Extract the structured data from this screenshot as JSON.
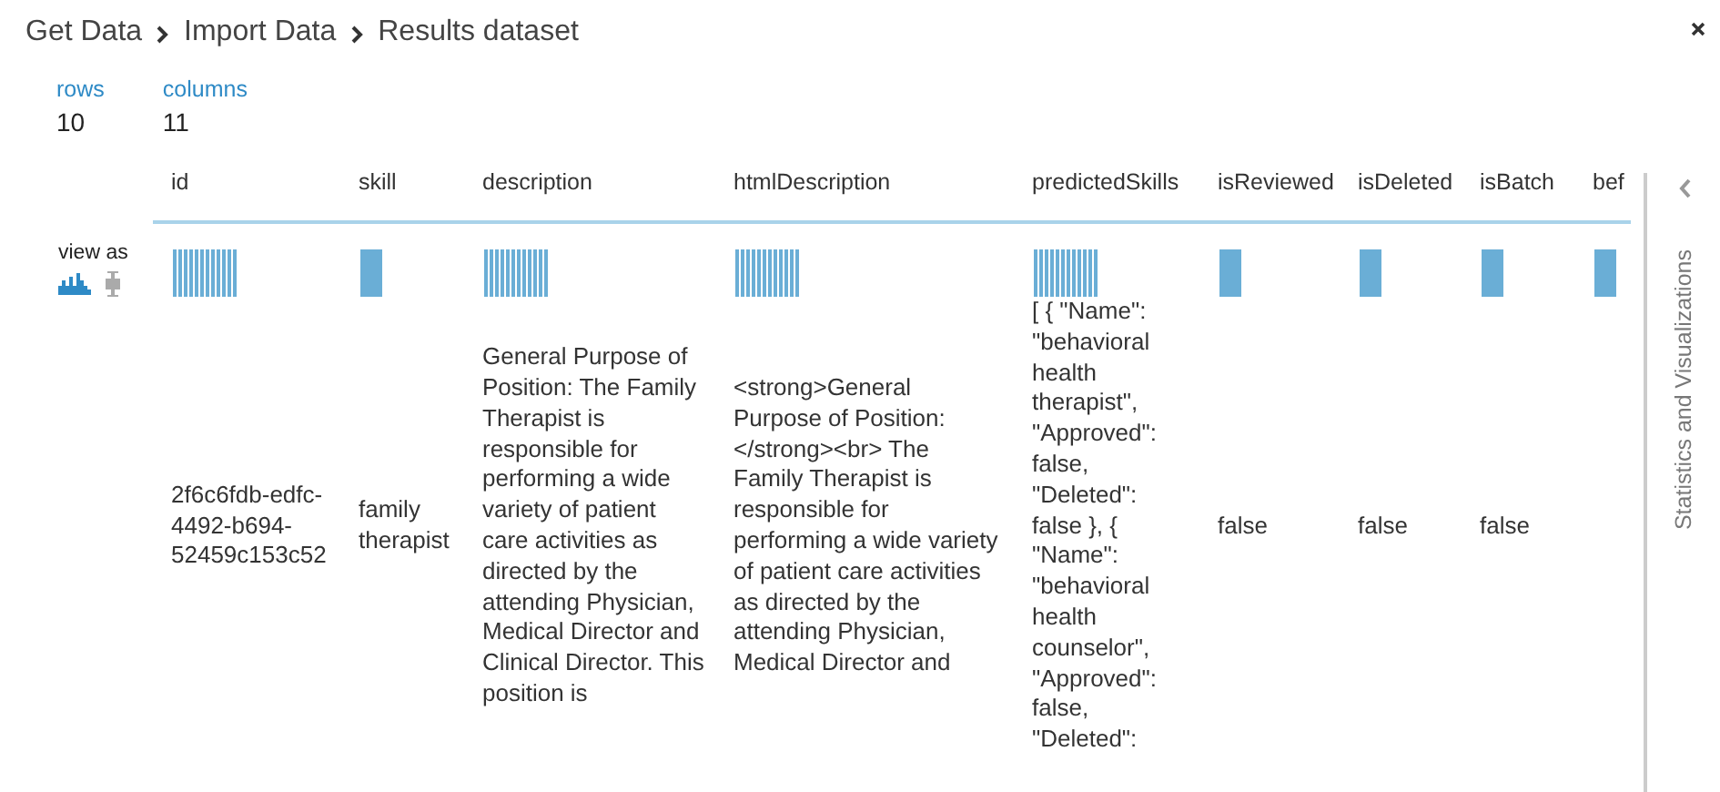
{
  "breadcrumb": [
    "Get Data",
    "Import Data",
    "Results dataset"
  ],
  "summary": [
    {
      "label": "rows",
      "value": "10"
    },
    {
      "label": "columns",
      "value": "11"
    }
  ],
  "view_as": {
    "label": "view as",
    "options": [
      {
        "kind": "histogram",
        "selected": true
      },
      {
        "kind": "boxplot",
        "selected": false
      }
    ]
  },
  "table": {
    "columns": [
      {
        "name": "id",
        "kind": "striped"
      },
      {
        "name": "skill",
        "kind": "solid"
      },
      {
        "name": "description",
        "kind": "striped"
      },
      {
        "name": "htmlDescription",
        "kind": "striped"
      },
      {
        "name": "predictedSkills",
        "kind": "striped"
      },
      {
        "name": "isReviewed",
        "kind": "solid"
      },
      {
        "name": "isDeleted",
        "kind": "solid"
      },
      {
        "name": "isBatch",
        "kind": "solid"
      },
      {
        "name": "bef",
        "kind": "solid"
      }
    ],
    "rows": [
      [
        "2f6c6fdb-edfc-4492-b694-52459c153c52",
        "family therapist",
        "General Purpose of Position: The Family Therapist is responsible for performing a wide variety of patient care activities as directed by the attending Physician, Medical Director and Clinical Director. This position is",
        "<strong>General Purpose of Position: </strong><br> The Family Therapist is responsible for performing a wide variety of patient care activities as directed by the attending Physician, Medical Director and",
        "[ { \"Name\": \"behavioral health therapist\", \"Approved\": false, \"Deleted\": false }, { \"Name\": \"behavioral health counselor\", \"Approved\": false, \"Deleted\":",
        "false",
        "false",
        "false"
      ]
    ]
  },
  "side_panel": {
    "title": "Statistics and Visualizations"
  }
}
